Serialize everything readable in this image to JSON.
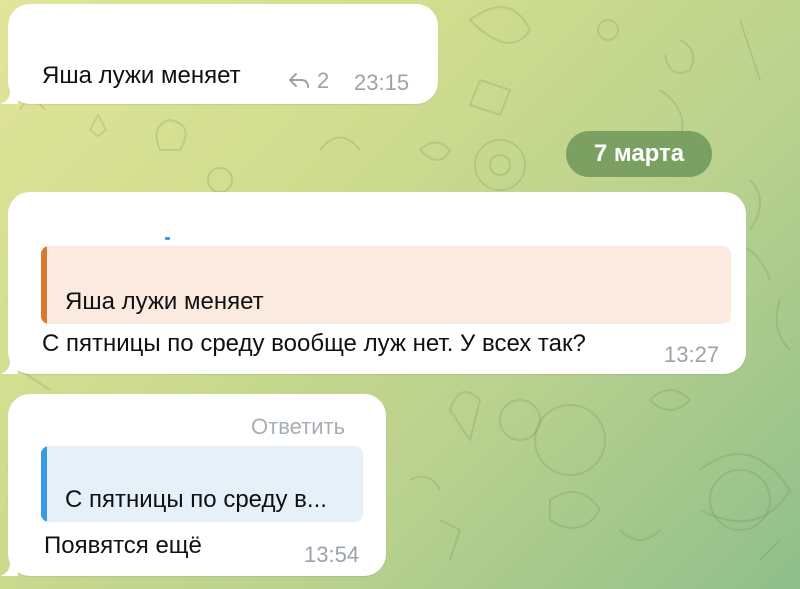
{
  "messages": [
    {
      "text": "Яша лужи меняет",
      "replies": "2",
      "time": "23:15"
    },
    {
      "quote": "Яша лужи меняет",
      "text": "С пятницы по среду вообще луж нет. У всех так?",
      "time": "13:27"
    },
    {
      "reply_label": "Ответить",
      "quote": "С пятницы по среду в...",
      "text": "Появятся ещё",
      "time": "13:54"
    }
  ],
  "date_separator": "7 марта",
  "colors": {
    "bubble": "#ffffff",
    "quote_orange_bar": "#d9782f",
    "quote_orange_bg": "#fbeae0",
    "quote_blue_bar": "#3a9be0",
    "quote_blue_bg": "#e6f0f9",
    "date_pill": "#6e965a",
    "meta_text": "#9aa3ab"
  },
  "icons": {
    "reply": "reply-arrow-icon"
  }
}
